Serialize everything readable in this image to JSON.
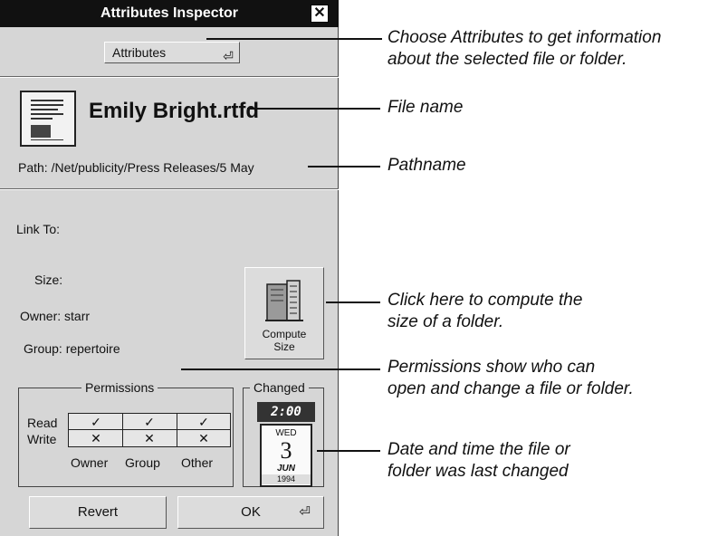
{
  "window": {
    "title": "Attributes Inspector",
    "close_glyph": "✕",
    "popup": {
      "selected": "Attributes",
      "arrow": "⏎"
    },
    "file": {
      "name": "Emily Bright.rtfd",
      "icon": "rtfd-document-icon",
      "path": "Path:  /Net/publicity/Press Releases/5 May"
    },
    "link_to_label": "Link To:",
    "size_label": "Size:",
    "owner_label": "Owner: starr",
    "group_label": "Group: repertoire",
    "compute_button": {
      "line1": "Compute",
      "line2": "Size"
    },
    "permissions": {
      "title": "Permissions",
      "rows": [
        {
          "label": "Read",
          "values": [
            "✓",
            "✓",
            "✓"
          ]
        },
        {
          "label": "Write",
          "values": [
            "✕",
            "✕",
            "✕"
          ]
        }
      ],
      "columns": [
        "Owner",
        "Group",
        "Other"
      ]
    },
    "changed": {
      "title": "Changed",
      "time": "2:00",
      "weekday": "WED",
      "day": "3",
      "month": "JUN",
      "year": "1994"
    },
    "revert_label": "Revert",
    "ok_label": "OK"
  },
  "callouts": {
    "attributes": [
      "Choose Attributes to get information",
      "about the selected file or folder."
    ],
    "file_name": "File name",
    "pathname": "Pathname",
    "compute": [
      "Click here to compute the",
      "size of a folder."
    ],
    "permissions": [
      "Permissions show who can",
      "open and change a file or folder."
    ],
    "changed": [
      "Date and time the file or",
      "folder was last changed"
    ]
  }
}
